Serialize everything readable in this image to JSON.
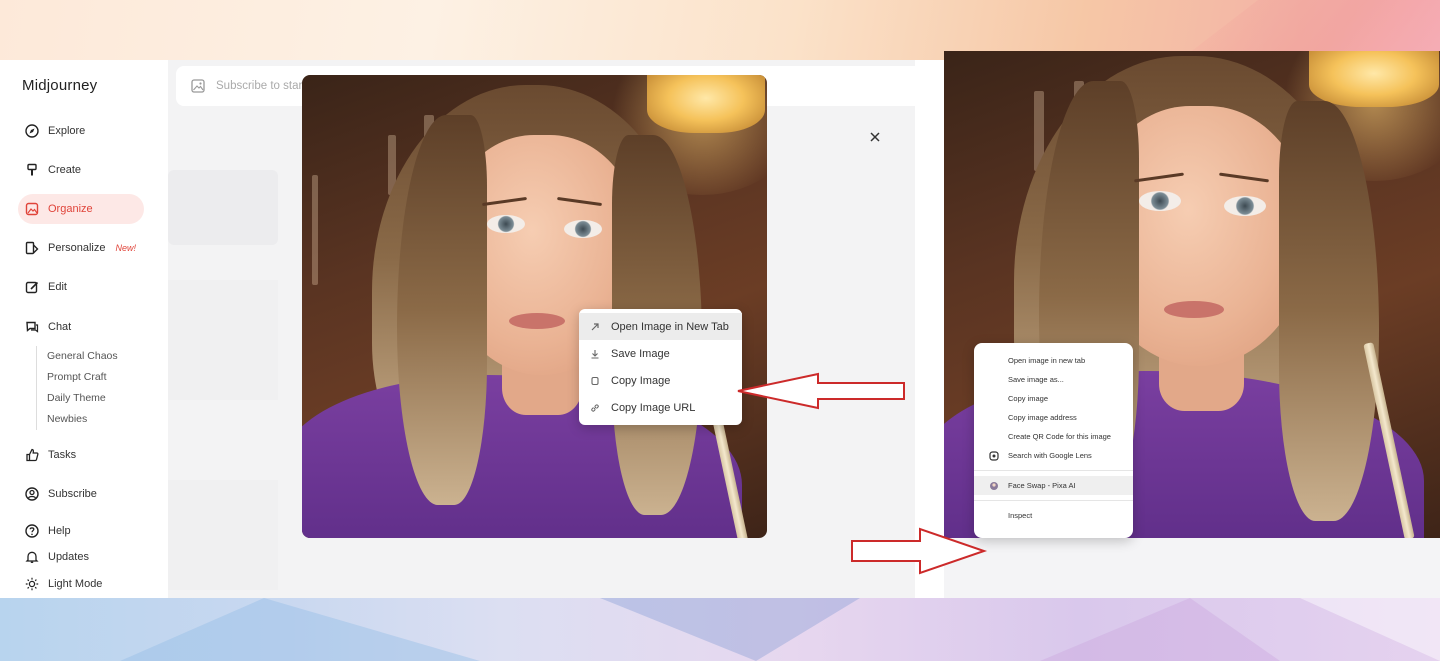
{
  "sidebar": {
    "brand": "Midjourney",
    "items": [
      {
        "label": "Explore",
        "icon": "compass-icon"
      },
      {
        "label": "Create",
        "icon": "brush-icon"
      },
      {
        "label": "Organize",
        "icon": "image-icon",
        "active": true
      },
      {
        "label": "Personalize",
        "icon": "personalize-icon",
        "badge": "New!"
      },
      {
        "label": "Edit",
        "icon": "edit-icon"
      },
      {
        "label": "Chat",
        "icon": "chat-icon"
      },
      {
        "label": "Tasks",
        "icon": "thumbs-up-icon"
      },
      {
        "label": "Subscribe",
        "icon": "user-circle-icon"
      },
      {
        "label": "Help",
        "icon": "help-icon"
      },
      {
        "label": "Updates",
        "icon": "bell-icon"
      },
      {
        "label": "Light Mode",
        "icon": "sun-icon"
      }
    ],
    "chat_channels": [
      "General Chaos",
      "Prompt Craft",
      "Daily Theme",
      "Newbies"
    ]
  },
  "search": {
    "placeholder": "Subscribe to start creating..."
  },
  "context_menu_midjourney": {
    "items": [
      {
        "label": "Open Image in New Tab",
        "icon": "external-arrow-icon",
        "highlighted": true
      },
      {
        "label": "Save Image",
        "icon": "download-icon"
      },
      {
        "label": "Copy Image",
        "icon": "copy-icon"
      },
      {
        "label": "Copy Image URL",
        "icon": "link-icon"
      }
    ]
  },
  "context_menu_browser": {
    "items": [
      {
        "label": "Open image in new tab"
      },
      {
        "label": "Save image as..."
      },
      {
        "label": "Copy image"
      },
      {
        "label": "Copy image address"
      },
      {
        "label": "Create QR Code for this image"
      },
      {
        "label": "Search with Google Lens",
        "icon": "lens-icon"
      },
      {
        "label": "Face Swap - Pixa AI",
        "icon": "extension-icon",
        "highlighted": true
      },
      {
        "label": "Inspect"
      }
    ]
  },
  "colors": {
    "accent": "#e0443a",
    "arrow": "#cc2a2a",
    "active_bg": "#fde8e6"
  }
}
